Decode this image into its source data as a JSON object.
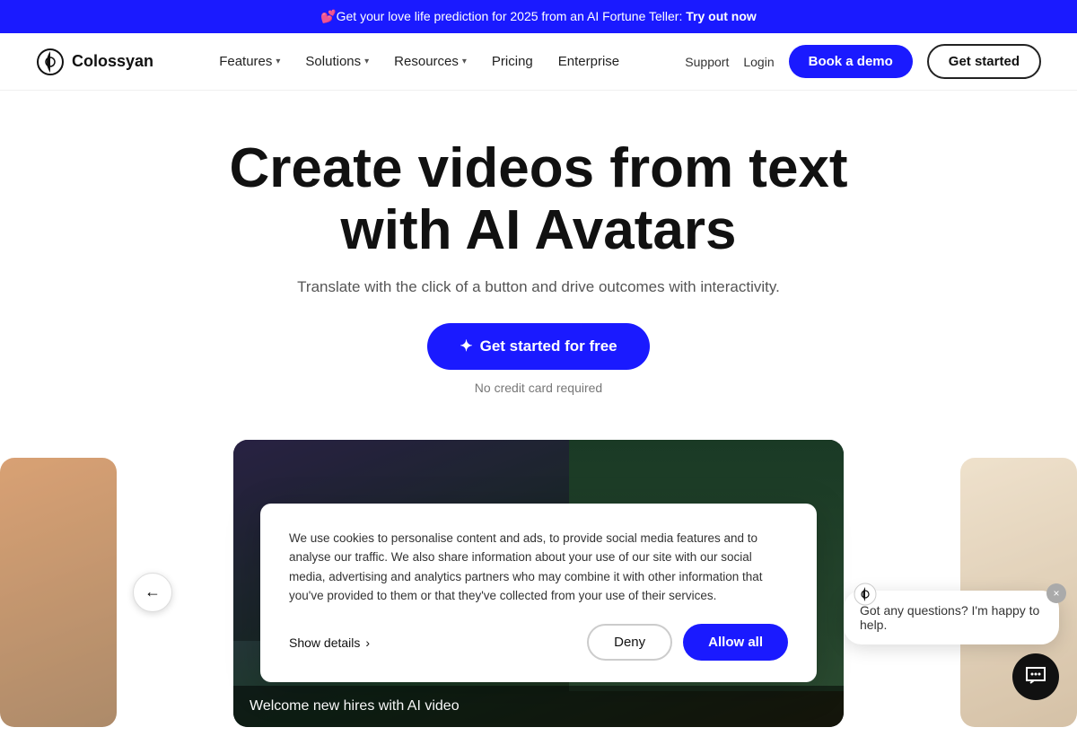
{
  "banner": {
    "text": "💕Get your love life prediction for 2025 from an AI Fortune Teller: ",
    "cta": "Try out now"
  },
  "navbar": {
    "logo_text": "Colossyan",
    "nav_items": [
      {
        "label": "Features",
        "has_dropdown": true
      },
      {
        "label": "Solutions",
        "has_dropdown": true
      },
      {
        "label": "Resources",
        "has_dropdown": true
      },
      {
        "label": "Pricing",
        "has_dropdown": false
      },
      {
        "label": "Enterprise",
        "has_dropdown": false
      }
    ],
    "support_label": "Support",
    "login_label": "Login",
    "book_demo_label": "Book a demo",
    "get_started_label": "Get started"
  },
  "hero": {
    "title": "Create videos from text with AI Avatars",
    "subtitle": "Translate with the click of a button and drive outcomes with interactivity.",
    "cta_label": "Get started for free",
    "cta_icon": "✦",
    "no_credit": "No credit card required"
  },
  "carousel": {
    "main_card_text": "Welcome new hires with AI video",
    "prev_icon": "←"
  },
  "cookie": {
    "text": "We use cookies to personalise content and ads, to provide social media features and to analyse our traffic. We also share information about your use of our site with our social media, advertising and analytics partners who may combine it with other information that you've provided to them or that they've collected from your use of their services.",
    "show_details_label": "Show details",
    "deny_label": "Deny",
    "allow_label": "Allow all"
  },
  "chat": {
    "message": "Got any questions? I'm happy to help.",
    "close_icon": "×",
    "button_icon": "💬"
  },
  "colors": {
    "primary": "#1a1aff",
    "text_dark": "#111111",
    "text_muted": "#555555"
  }
}
